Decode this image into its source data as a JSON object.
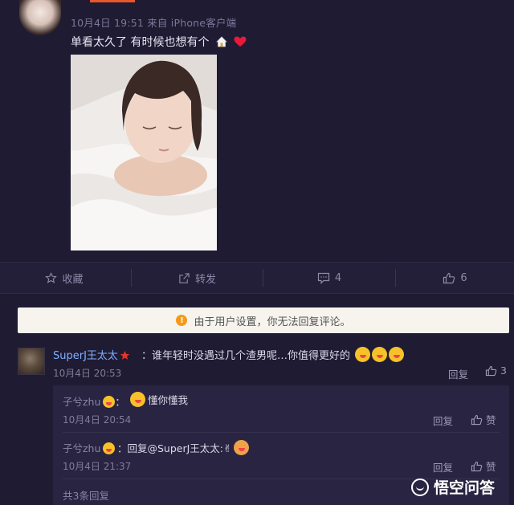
{
  "post": {
    "meta": "10月4日 19:51 来自 iPhone客户端",
    "text": "单看太久了 有时候也想有个",
    "actions": [
      {
        "icon": "star-icon",
        "label": "收藏"
      },
      {
        "icon": "share-icon",
        "label": "转发"
      },
      {
        "icon": "comment-icon",
        "label": "4"
      },
      {
        "icon": "thumbs-up-icon",
        "label": "6"
      }
    ]
  },
  "notice": "由于用户设置，你无法回复评论。",
  "comment": {
    "author": "SuperJ王太太",
    "text": "：谁年轻时没遇过几个渣男呢…你值得更好的",
    "time": "10月4日 20:53",
    "reply_label": "回复",
    "likes": "3"
  },
  "replies": [
    {
      "author": "子兮zhu",
      "text": "懂你懂我",
      "time": "10月4日 20:54",
      "reply_label": "回复",
      "like_label": "赞"
    },
    {
      "author": "子兮zhu",
      "text": "：回复@SuperJ王太太:",
      "time": "10月4日 21:37",
      "reply_label": "回复",
      "like_label": "赞"
    }
  ],
  "more_replies": "共3条回复",
  "watermark": "悟空问答",
  "colors": {
    "background": "#1f1b33",
    "link": "#7fb0ff",
    "notice_bg": "#f7f4ee",
    "accent": "#e8562a"
  }
}
